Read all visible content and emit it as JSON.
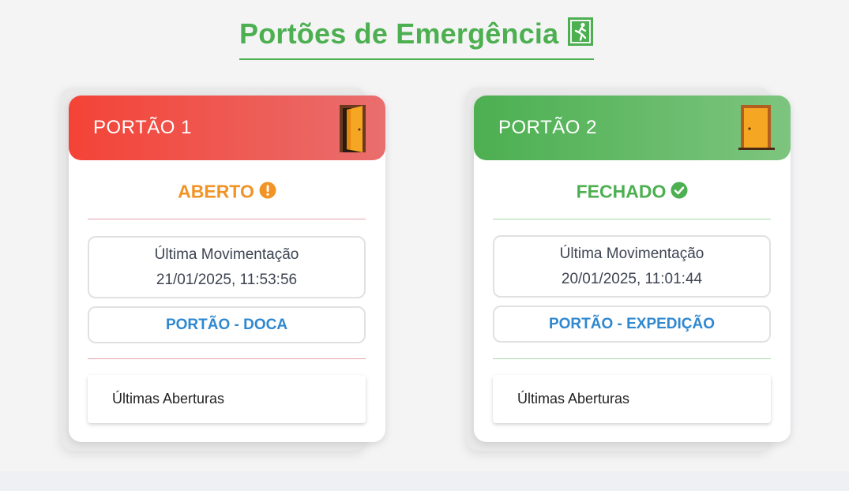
{
  "page": {
    "title": "Portões de Emergência",
    "title_icon": "emergency-exit-icon",
    "title_color": "#4caf50"
  },
  "gates": [
    {
      "name": "PORTÃO 1",
      "status": "ABERTO",
      "status_icon": "exclamation-circle-icon",
      "status_color": "#f19325",
      "header_colors": [
        "#f44336",
        "#e96e6e"
      ],
      "door_icon": "open-door-icon",
      "last_movement_label": "Última Movimentação",
      "last_movement_date": "21/01/2025, 11:53:56",
      "gate_label": "PORTÃO - DOCA",
      "openings_label": "Últimas Aberturas"
    },
    {
      "name": "PORTÃO 2",
      "status": "FECHADO",
      "status_icon": "check-circle-icon",
      "status_color": "#4caf50",
      "header_colors": [
        "#4caf50",
        "#7dc57f"
      ],
      "door_icon": "closed-door-icon",
      "last_movement_label": "Última Movimentação",
      "last_movement_date": "20/01/2025, 11:01:44",
      "gate_label": "PORTÃO - EXPEDIÇÃO",
      "openings_label": "Últimas Aberturas"
    }
  ]
}
